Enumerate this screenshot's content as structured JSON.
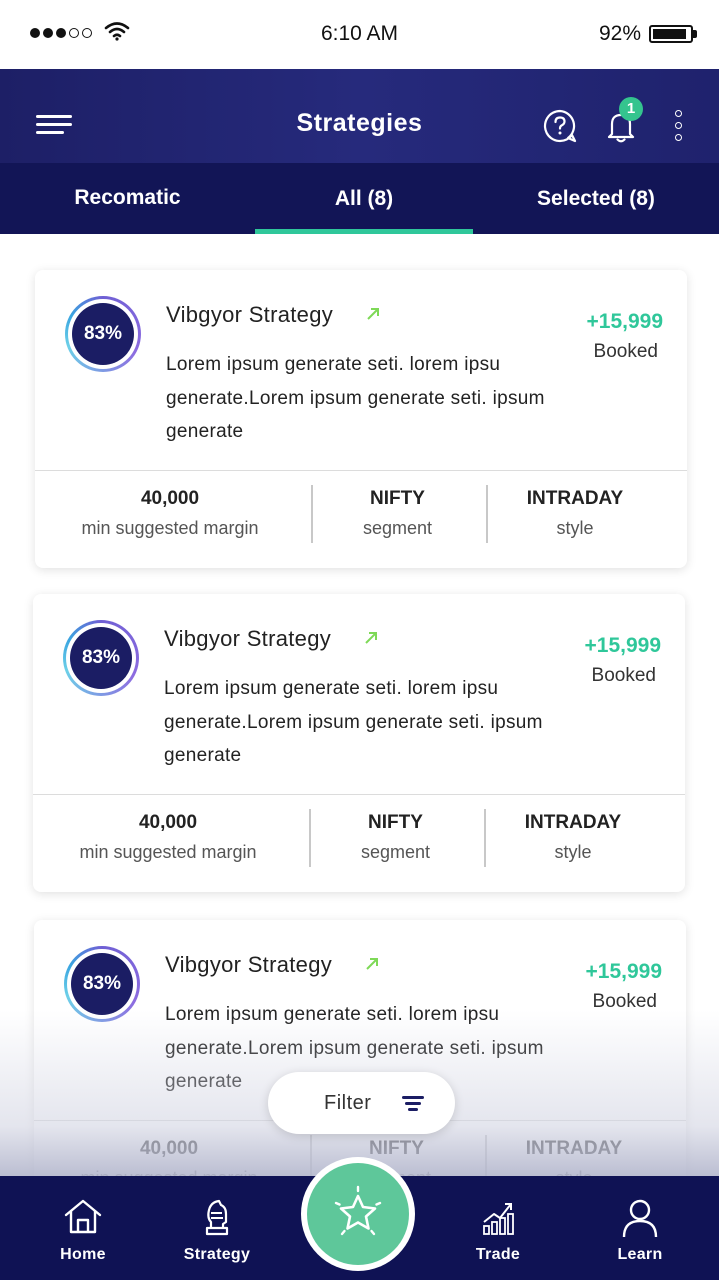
{
  "status_bar": {
    "time": "6:10 AM",
    "battery": "92%",
    "battery_level": 0.92
  },
  "header": {
    "title": "Strategies",
    "notification_count": "1"
  },
  "tabs": [
    {
      "label": "Recomatic",
      "active": false
    },
    {
      "label": "All (8)",
      "active": true
    },
    {
      "label": "Selected (8)",
      "active": false
    }
  ],
  "strategies": [
    {
      "score": "83%",
      "score_value": 0.83,
      "name": "Vibgyor Strategy",
      "description": "Lorem ipsum generate  seti. lorem ipsu generate.Lorem ipsum generate  seti. ipsum generate",
      "pnl": "+15,999",
      "pnl_status": "Booked",
      "margin_value": "40,000",
      "margin_label": "min suggested margin",
      "segment_value": "NIFTY",
      "segment_label": "segment",
      "style_value": "INTRADAY",
      "style_label": "style"
    },
    {
      "score": "83%",
      "score_value": 0.83,
      "name": "Vibgyor Strategy",
      "description": "Lorem ipsum generate  seti. lorem ipsu generate.Lorem ipsum generate  seti. ipsum generate",
      "pnl": "+15,999",
      "pnl_status": "Booked",
      "margin_value": "40,000",
      "margin_label": "min suggested margin",
      "segment_value": "NIFTY",
      "segment_label": "segment",
      "style_value": "INTRADAY",
      "style_label": "style"
    },
    {
      "score": "83%",
      "score_value": 0.83,
      "name": "Vibgyor Strategy",
      "description": "Lorem ipsum generate  seti. lorem ipsu generate.Lorem ipsum generate  seti. ipsum generate",
      "pnl": "+15,999",
      "pnl_status": "Booked",
      "margin_value": "40,000",
      "margin_label": "min suggested margin",
      "segment_value": "NIFTY",
      "segment_label": "segment",
      "style_value": "INTRADAY",
      "style_label": "style"
    }
  ],
  "filter": {
    "label": "Filter"
  },
  "bottom_nav": {
    "home": "Home",
    "strategy": "Strategy",
    "trade": "Trade",
    "learn": "Learn"
  },
  "colors": {
    "header": "#1f226d",
    "tabs": "#121556",
    "accent_green": "#2fc79a",
    "nav": "#0f1254",
    "fab": "#5ec79a"
  }
}
